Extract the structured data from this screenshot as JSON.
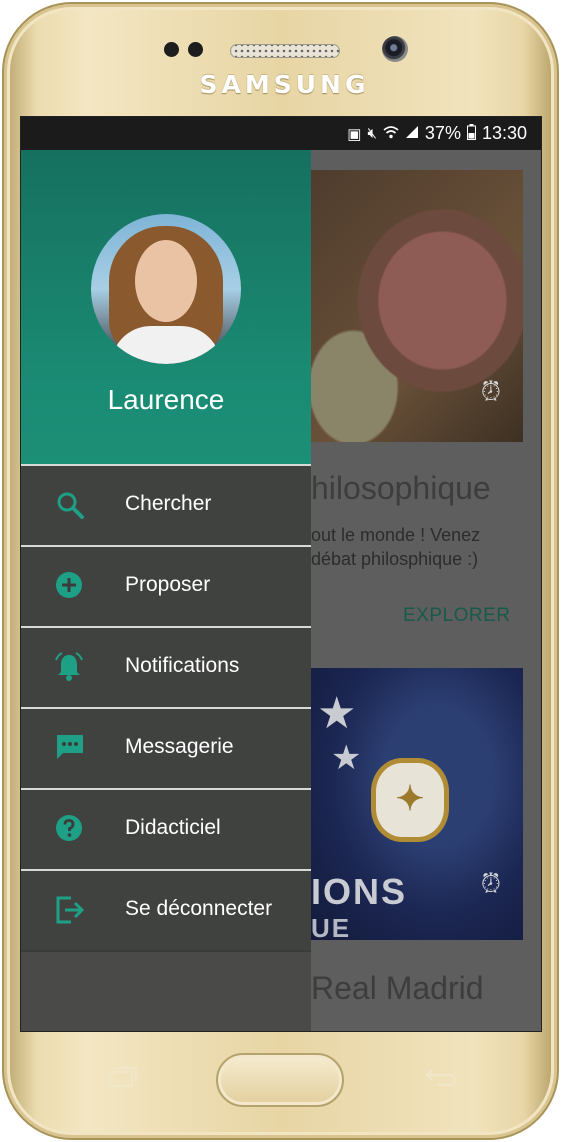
{
  "device": {
    "brand": "SAMSUNG"
  },
  "statusbar": {
    "battery": "37%",
    "time": "13:30"
  },
  "drawer": {
    "username": "Laurence",
    "items": [
      {
        "label": "Chercher",
        "icon": "search-icon"
      },
      {
        "label": "Proposer",
        "icon": "add-circle-icon"
      },
      {
        "label": "Notifications",
        "icon": "bell-icon"
      },
      {
        "label": "Messagerie",
        "icon": "chat-icon"
      },
      {
        "label": "Didacticiel",
        "icon": "help-icon"
      },
      {
        "label": "Se déconnecter",
        "icon": "logout-icon"
      }
    ]
  },
  "feed": {
    "card1": {
      "title": "hilosophique",
      "desc_line1": "out le monde ! Venez",
      "desc_line2": "débat philosphique :)",
      "action": "EXPLORER"
    },
    "card2": {
      "banner_line1": "IONS",
      "banner_line2": "UE",
      "title": "Real Madrid"
    }
  },
  "colors": {
    "accent": "#1ea086",
    "header": "#1a8a73"
  }
}
